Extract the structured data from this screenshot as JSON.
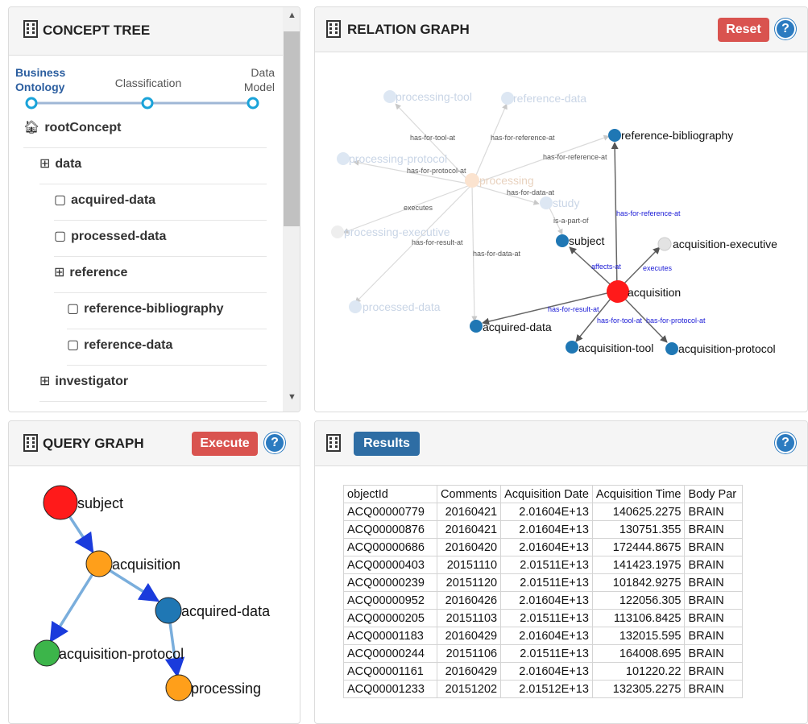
{
  "concept_tree": {
    "title": "CONCEPT TREE",
    "stepper": [
      "Business Ontology",
      "Classification",
      "Data Model"
    ],
    "root": "rootConcept",
    "nodes": [
      {
        "label": "data",
        "kind": "expand"
      },
      {
        "label": "acquired-data",
        "kind": "leaf"
      },
      {
        "label": "processed-data",
        "kind": "leaf"
      },
      {
        "label": "reference",
        "kind": "expand"
      },
      {
        "label": "reference-bibliography",
        "kind": "leaf"
      },
      {
        "label": "reference-data",
        "kind": "leaf"
      },
      {
        "label": "investigator",
        "kind": "expand"
      }
    ]
  },
  "relation_graph": {
    "title": "RELATION GRAPH",
    "reset_label": "Reset",
    "faded_nodes": [
      "processing-tool",
      "reference-data",
      "processing-protocol",
      "processing",
      "study",
      "processing-executive",
      "processed-data"
    ],
    "faded_edges": [
      "has-for-tool-at",
      "has-for-reference-at",
      "has-for-reference-at",
      "has-for-protocol-at",
      "has-for-data-at",
      "executes",
      "is-a-part-of",
      "has-for-result-at",
      "has-for-data-at"
    ],
    "active_nodes": [
      "reference-bibliography",
      "subject",
      "acquisition-executive",
      "acquisition",
      "acquired-data",
      "acquisition-tool",
      "acquisition-protocol"
    ],
    "active_edges": [
      "has-for-reference-at",
      "affects-at",
      "executes",
      "has-for-result-at",
      "has-for-tool-at",
      "has-for-protocol-at"
    ]
  },
  "query_graph": {
    "title": "QUERY GRAPH",
    "execute_label": "Execute",
    "nodes": [
      {
        "label": "subject",
        "color": "#ff1a1a"
      },
      {
        "label": "acquisition",
        "color": "#ff9f1a"
      },
      {
        "label": "acquired-data",
        "color": "#1f77b4"
      },
      {
        "label": "acquisition-protocol",
        "color": "#3cb54a"
      },
      {
        "label": "processing",
        "color": "#ff9f1a"
      }
    ]
  },
  "results": {
    "title": "Results",
    "columns": [
      "objectId",
      "Comments",
      "Acquisition Date",
      "Acquisition Time",
      "Body Par"
    ],
    "rows": [
      [
        "ACQ00000779",
        "20160421",
        "2.01604E+13",
        "140625.2275",
        "BRAIN"
      ],
      [
        "ACQ00000876",
        "20160421",
        "2.01604E+13",
        "130751.355",
        "BRAIN"
      ],
      [
        "ACQ00000686",
        "20160420",
        "2.01604E+13",
        "172444.8675",
        "BRAIN"
      ],
      [
        "ACQ00000403",
        "20151110",
        "2.01511E+13",
        "141423.1975",
        "BRAIN"
      ],
      [
        "ACQ00000239",
        "20151120",
        "2.01511E+13",
        "101842.9275",
        "BRAIN"
      ],
      [
        "ACQ00000952",
        "20160426",
        "2.01604E+13",
        "122056.305",
        "BRAIN"
      ],
      [
        "ACQ00000205",
        "20151103",
        "2.01511E+13",
        "113106.8425",
        "BRAIN"
      ],
      [
        "ACQ00001183",
        "20160429",
        "2.01604E+13",
        "132015.595",
        "BRAIN"
      ],
      [
        "ACQ00000244",
        "20151106",
        "2.01511E+13",
        "164008.695",
        "BRAIN"
      ],
      [
        "ACQ00001161",
        "20160429",
        "2.01604E+13",
        "101220.22",
        "BRAIN"
      ],
      [
        "ACQ00001233",
        "20151202",
        "2.01512E+13",
        "132305.2275",
        "BRAIN"
      ]
    ]
  },
  "help_symbol": "?",
  "colors": {
    "danger": "#d9534f",
    "primary": "#2e6da4",
    "node_blue": "#1f77b4",
    "node_red": "#ff1a1a",
    "node_orange": "#ff9f1a",
    "node_green": "#3cb54a"
  }
}
